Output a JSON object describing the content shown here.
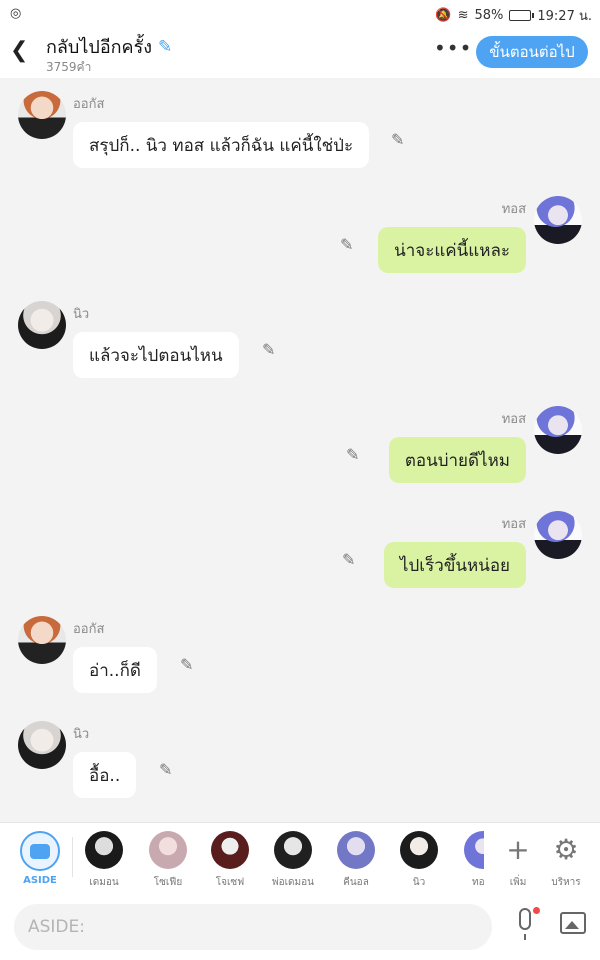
{
  "status_bar": {
    "battery": "58%",
    "time": "19:27 น."
  },
  "header": {
    "title": "กลับไปอีกครั้ง",
    "word_count": "3759คำ",
    "more_label": "•••",
    "next_button": "ขั้นตอนต่อไป"
  },
  "messages": [
    {
      "speaker": "ออกัส",
      "text": "สรุปก็.. นิว ทอส แล้วก็ฉัน แค่นี้ใช่ป่ะ",
      "side": "left"
    },
    {
      "speaker": "ทอส",
      "text": "น่าจะแค่นี้แหละ",
      "side": "right"
    },
    {
      "speaker": "นิว",
      "text": "แล้วจะไปตอนไหน",
      "side": "left"
    },
    {
      "speaker": "ทอส",
      "text": "ตอนบ่ายดีไหม",
      "side": "right"
    },
    {
      "speaker": "ทอส",
      "text": "ไปเร็วขึ้นหน่อย",
      "side": "right"
    },
    {
      "speaker": "ออกัส",
      "text": "อ่า..ก็ดี",
      "side": "left"
    },
    {
      "speaker": "นิว",
      "text": "อื้อ..",
      "side": "left"
    }
  ],
  "characters": {
    "aside_label": "ASIDE",
    "items": [
      {
        "label": "เดมอน"
      },
      {
        "label": "โซเฟีย"
      },
      {
        "label": "โจเซฟ"
      },
      {
        "label": "พ่อเดมอน"
      },
      {
        "label": "คีนอล"
      },
      {
        "label": "นิว"
      },
      {
        "label": "ทอ"
      }
    ],
    "add_label": "เพิ่ม",
    "manage_label": "บริหาร"
  },
  "input": {
    "placeholder": "ASIDE:"
  },
  "colors": {
    "accent": "#4ea4f2",
    "right_bubble": "#daf3a2",
    "left_bubble": "#ffffff"
  }
}
